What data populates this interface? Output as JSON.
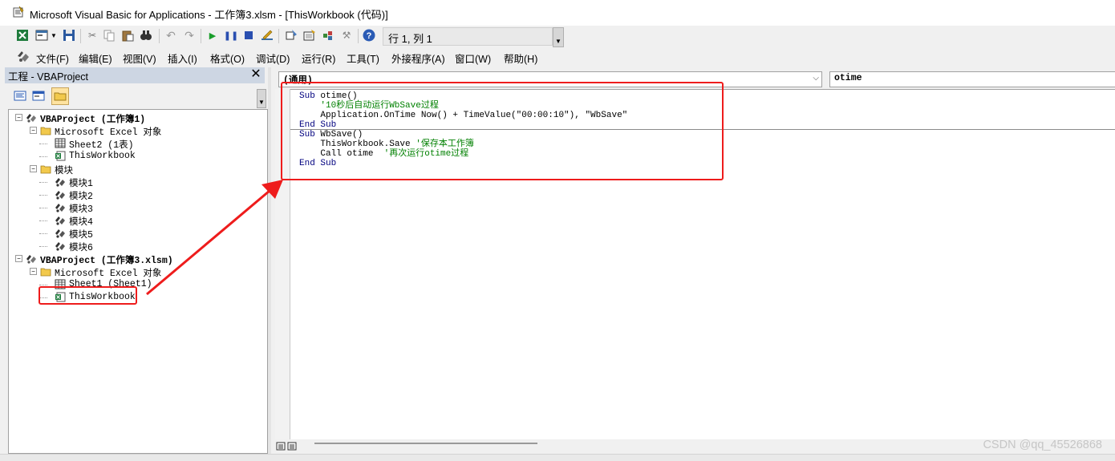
{
  "window": {
    "title": "Microsoft Visual Basic for Applications - 工作簿3.xlsm - [ThisWorkbook (代码)]"
  },
  "toolbar": {
    "position_text": "行 1, 列 1",
    "buttons": [
      "excel-view",
      "insert-userform",
      "save",
      "cut",
      "copy",
      "paste",
      "find",
      "undo",
      "redo",
      "run",
      "break",
      "reset",
      "design-mode",
      "project-explorer",
      "properties",
      "object-browser",
      "toolbox",
      "help"
    ]
  },
  "menu": {
    "items": [
      "文件(F)",
      "编辑(E)",
      "视图(V)",
      "插入(I)",
      "格式(O)",
      "调试(D)",
      "运行(R)",
      "工具(T)",
      "外接程序(A)",
      "窗口(W)",
      "帮助(H)"
    ]
  },
  "project_panel": {
    "title": "工程 - VBAProject",
    "close": "✕",
    "tree": [
      {
        "label": "VBAProject (工作簿1)",
        "level": 0,
        "bold": true,
        "icon": "vbaproject-icon",
        "expander": "−"
      },
      {
        "label": "Microsoft Excel 对象",
        "level": 1,
        "icon": "folder-icon",
        "expander": "−"
      },
      {
        "label": "Sheet2 (1表)",
        "level": 2,
        "icon": "sheet-icon"
      },
      {
        "label": "ThisWorkbook",
        "level": 2,
        "icon": "workbook-icon"
      },
      {
        "label": "模块",
        "level": 1,
        "icon": "folder-icon",
        "expander": "−"
      },
      {
        "label": "模块1",
        "level": 2,
        "icon": "module-icon"
      },
      {
        "label": "模块2",
        "level": 2,
        "icon": "module-icon"
      },
      {
        "label": "模块3",
        "level": 2,
        "icon": "module-icon"
      },
      {
        "label": "模块4",
        "level": 2,
        "icon": "module-icon"
      },
      {
        "label": "模块5",
        "level": 2,
        "icon": "module-icon"
      },
      {
        "label": "模块6",
        "level": 2,
        "icon": "module-icon"
      },
      {
        "label": "VBAProject (工作簿3.xlsm)",
        "level": 0,
        "bold": true,
        "icon": "vbaproject-icon",
        "expander": "−"
      },
      {
        "label": "Microsoft Excel 对象",
        "level": 1,
        "icon": "folder-icon",
        "expander": "−"
      },
      {
        "label": "Sheet1 (Sheet1)",
        "level": 2,
        "icon": "sheet-icon"
      },
      {
        "label": "ThisWorkbook",
        "level": 2,
        "icon": "workbook-icon",
        "highlighted": true
      }
    ]
  },
  "code_window": {
    "object_combo": "(通用)",
    "procedure_combo": "otime",
    "lines": [
      [
        {
          "t": "Sub",
          "c": "kw"
        },
        {
          "t": " otime()",
          "c": ""
        }
      ],
      [
        {
          "t": "    '10秒后自动运行WbSave过程",
          "c": "cm"
        }
      ],
      [
        {
          "t": "    Application.OnTime Now() + TimeValue(\"00:00:10\"), \"WbSave\"",
          "c": ""
        }
      ],
      [
        {
          "t": "End Sub",
          "c": "kw"
        }
      ],
      [
        {
          "t": "Sub",
          "c": "kw"
        },
        {
          "t": " WbSave()",
          "c": ""
        }
      ],
      [
        {
          "t": "    ThisWorkbook.Save ",
          "c": ""
        },
        {
          "t": "'保存本工作簿",
          "c": "cm"
        }
      ],
      [
        {
          "t": "    Call otime  ",
          "c": ""
        },
        {
          "t": "'再次运行otime过程",
          "c": "cm"
        }
      ],
      [
        {
          "t": "End Sub",
          "c": "kw"
        }
      ]
    ]
  },
  "annotation_color": "#ee1c1c",
  "watermark": "CSDN @qq_45526868"
}
